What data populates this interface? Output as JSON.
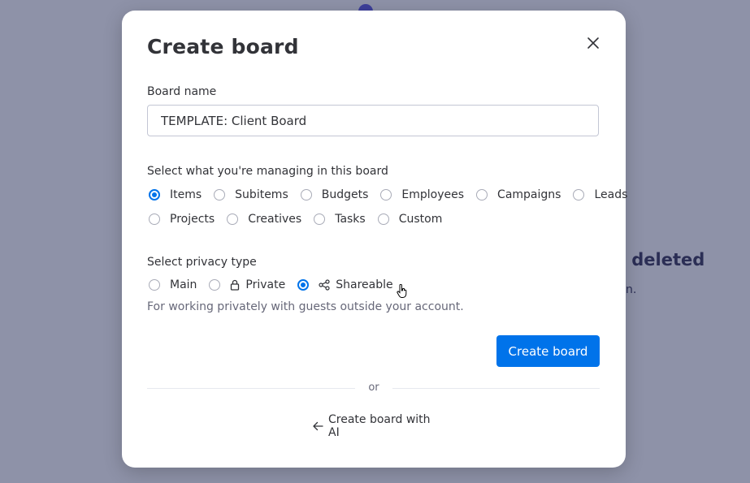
{
  "background": {
    "title_fragment": "n deleted",
    "sub_fragment": "n."
  },
  "modal": {
    "title": "Create board",
    "close_icon": "close-icon",
    "board_name": {
      "label": "Board name",
      "value": "TEMPLATE: Client Board"
    },
    "managing": {
      "label": "Select what you're managing in this board",
      "options": [
        "Items",
        "Subitems",
        "Budgets",
        "Employees",
        "Campaigns",
        "Leads",
        "Projects",
        "Creatives",
        "Tasks",
        "Custom"
      ],
      "selected": "Items"
    },
    "privacy": {
      "label": "Select privacy type",
      "options": [
        {
          "label": "Main",
          "icon": ""
        },
        {
          "label": "Private",
          "icon": "lock-icon"
        },
        {
          "label": "Shareable",
          "icon": "share-icon"
        }
      ],
      "selected": "Shareable",
      "hint": "For working privately with guests outside your account."
    },
    "create_button": "Create board",
    "or_text": "or",
    "ai_link": "Create board with AI"
  },
  "colors": {
    "primary": "#0073ea",
    "overlay": "#8e92a8",
    "text": "#323338",
    "secondary_text": "#676879"
  }
}
